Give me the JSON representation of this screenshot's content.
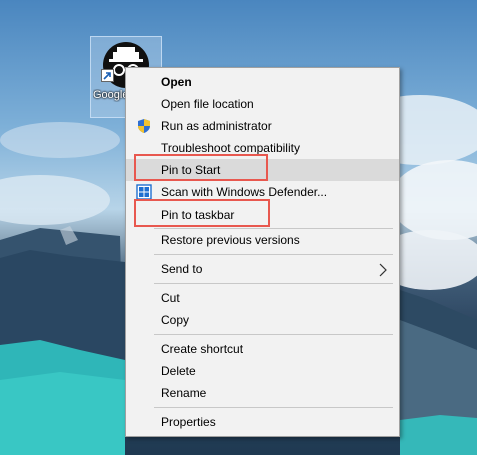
{
  "desktop": {
    "icon_label": "Google Chrome",
    "icon_name": "incognito-icon"
  },
  "menu": {
    "items": [
      {
        "label": "Open",
        "bold": true
      },
      {
        "label": "Open file location"
      },
      {
        "label": "Run as administrator",
        "icon": "uac-shield-icon"
      },
      {
        "label": "Troubleshoot compatibility"
      },
      {
        "label": "Pin to Start",
        "hover": true
      },
      {
        "label": "Scan with Windows Defender...",
        "icon": "windows-defender-icon"
      },
      {
        "label": "Pin to taskbar"
      },
      {
        "label": "Restore previous versions"
      },
      {
        "label": "Send to",
        "submenu": true
      },
      {
        "label": "Cut"
      },
      {
        "label": "Copy"
      },
      {
        "label": "Create shortcut"
      },
      {
        "label": "Delete"
      },
      {
        "label": "Rename"
      },
      {
        "label": "Properties"
      }
    ]
  },
  "colors": {
    "highlight_border": "#e8584f",
    "menu_background": "#f2f2f2",
    "hover_background": "#dadada"
  }
}
